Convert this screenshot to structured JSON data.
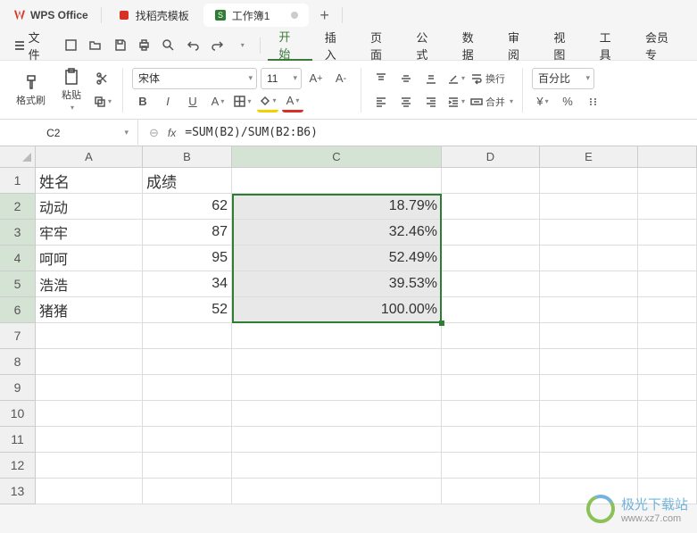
{
  "app": {
    "name": "WPS Office"
  },
  "tabs": [
    {
      "label": "找稻壳模板",
      "active": false
    },
    {
      "label": "工作簿1",
      "active": true
    }
  ],
  "menu": {
    "file": "文件",
    "items": [
      "开始",
      "插入",
      "页面",
      "公式",
      "数据",
      "审阅",
      "视图",
      "工具",
      "会员专"
    ],
    "active_index": 0
  },
  "toolbar": {
    "format_painter": "格式刷",
    "paste": "粘贴",
    "font_name": "宋体",
    "font_size": "11",
    "wrap": "换行",
    "merge": "合并",
    "number_format": "百分比",
    "currency": "¥",
    "percent": "%"
  },
  "namebox": "C2",
  "formula": "=SUM(B2)/SUM(B2:B6)",
  "columns": [
    "A",
    "B",
    "C",
    "D",
    "E"
  ],
  "rows": [
    "1",
    "2",
    "3",
    "4",
    "5",
    "6",
    "7",
    "8",
    "9",
    "10",
    "11",
    "12",
    "13"
  ],
  "chart_data": {
    "type": "table",
    "headers": {
      "A": "姓名",
      "B": "成绩"
    },
    "records": [
      {
        "name": "动动",
        "score": 62,
        "pct": "18.79%"
      },
      {
        "name": "牢牢",
        "score": 87,
        "pct": "32.46%"
      },
      {
        "name": "呵呵",
        "score": 95,
        "pct": "52.49%"
      },
      {
        "name": "浩浩",
        "score": 34,
        "pct": "39.53%"
      },
      {
        "name": "猪猪",
        "score": 52,
        "pct": "100.00%"
      }
    ]
  },
  "watermark": {
    "text": "极光下载站",
    "url": "www.xz7.com"
  },
  "selected_col": "C",
  "selected_rows": [
    2,
    3,
    4,
    5,
    6
  ]
}
